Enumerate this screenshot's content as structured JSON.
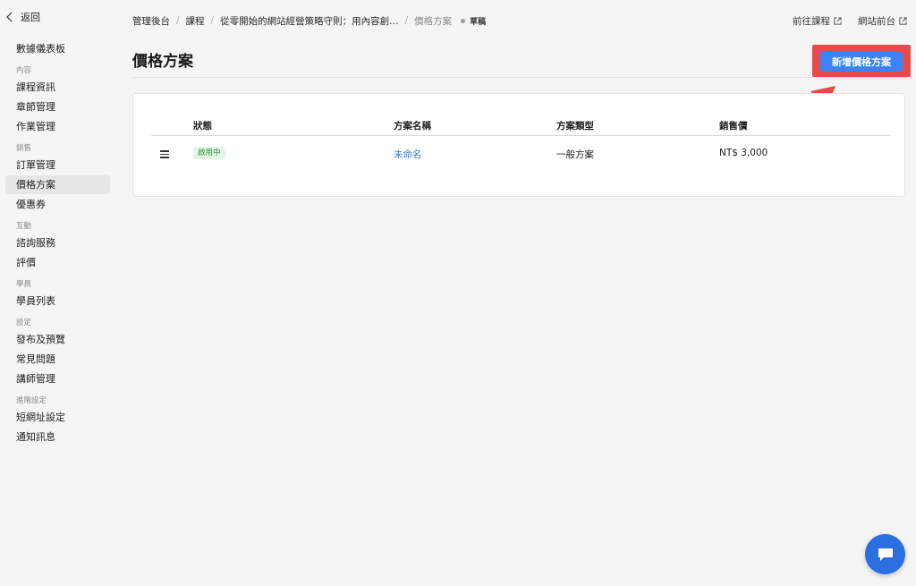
{
  "sidebar": {
    "back_label": "返回",
    "dashboard": "數據儀表板",
    "sections": [
      {
        "title": "內容",
        "items": [
          "課程資訊",
          "章節管理",
          "作業管理"
        ]
      },
      {
        "title": "銷售",
        "items": [
          "訂單管理",
          "價格方案",
          "優惠券"
        ]
      },
      {
        "title": "互動",
        "items": [
          "諮詢服務",
          "評價"
        ]
      },
      {
        "title": "學員",
        "items": [
          "學員列表"
        ]
      },
      {
        "title": "設定",
        "items": [
          "發布及預覽",
          "常見問題",
          "講師管理"
        ]
      },
      {
        "title": "進階設定",
        "items": [
          "短網址設定",
          "通知訊息"
        ]
      }
    ],
    "active_item": "價格方案"
  },
  "breadcrumb": {
    "items": [
      "管理後台",
      "課程",
      "從零開始的網站經營策略守則：用內容創…",
      "價格方案"
    ],
    "status": "草稿"
  },
  "top_links": {
    "go_course": "前往課程",
    "site_front": "網站前台"
  },
  "page": {
    "title": "價格方案",
    "add_button": "新增價格方案"
  },
  "table": {
    "headers": [
      "狀態",
      "方案名稱",
      "方案類型",
      "銷售價"
    ],
    "rows": [
      {
        "status": "啟用中",
        "name": "未命名",
        "type": "一般方案",
        "price": "NT$ 3,000"
      }
    ]
  },
  "colors": {
    "accent": "#3b82f6",
    "highlight": "#e84a4a",
    "badge_bg": "#e3f6e5",
    "badge_text": "#2f8f3f",
    "link": "#3578e5"
  },
  "icons": [
    "chevron-left-icon",
    "external-link-icon",
    "drag-handle-icon",
    "chat-icon",
    "annotation-arrow"
  ]
}
